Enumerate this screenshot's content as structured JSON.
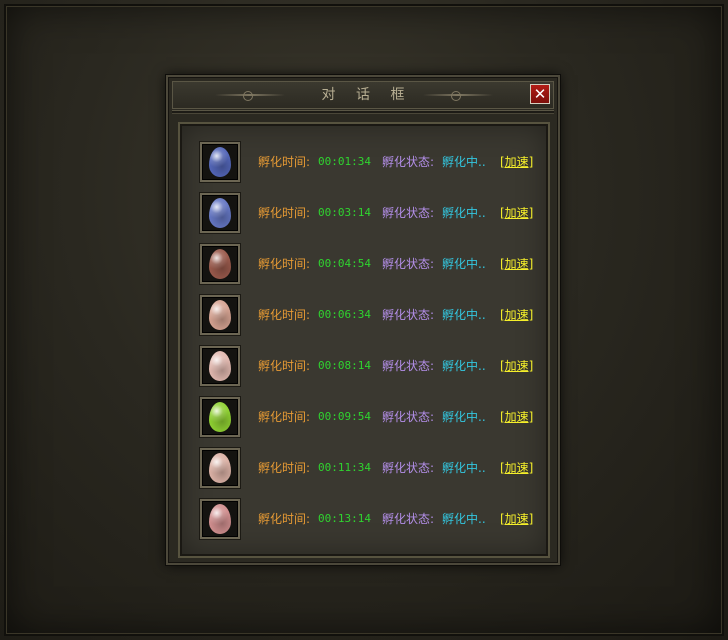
{
  "dialog": {
    "title": "对 话 框",
    "close_symbol": "✕"
  },
  "labels": {
    "time": "孵化时间:",
    "status": "孵化状态:",
    "speedup": "[加速]"
  },
  "eggs": [
    {
      "icon": "blue-egg-icon",
      "color": "#5366b8",
      "time": "00:01:34",
      "status": "孵化中.."
    },
    {
      "icon": "blue-egg-icon",
      "color": "#6577c4",
      "time": "00:03:14",
      "status": "孵化中.."
    },
    {
      "icon": "brown-egg-icon",
      "color": "#9a5a4c",
      "time": "00:04:54",
      "status": "孵化中.."
    },
    {
      "icon": "pink-egg-icon",
      "color": "#d6a392",
      "time": "00:06:34",
      "status": "孵化中.."
    },
    {
      "icon": "pink-egg-icon",
      "color": "#e2b9b0",
      "time": "00:08:14",
      "status": "孵化中.."
    },
    {
      "icon": "green-egg-icon",
      "color": "#8fd132",
      "time": "00:09:54",
      "status": "孵化中.."
    },
    {
      "icon": "pink-egg-icon",
      "color": "#dcb2a6",
      "time": "00:11:34",
      "status": "孵化中.."
    },
    {
      "icon": "pink-egg-icon",
      "color": "#d18f8f",
      "time": "00:13:14",
      "status": "孵化中.."
    }
  ]
}
